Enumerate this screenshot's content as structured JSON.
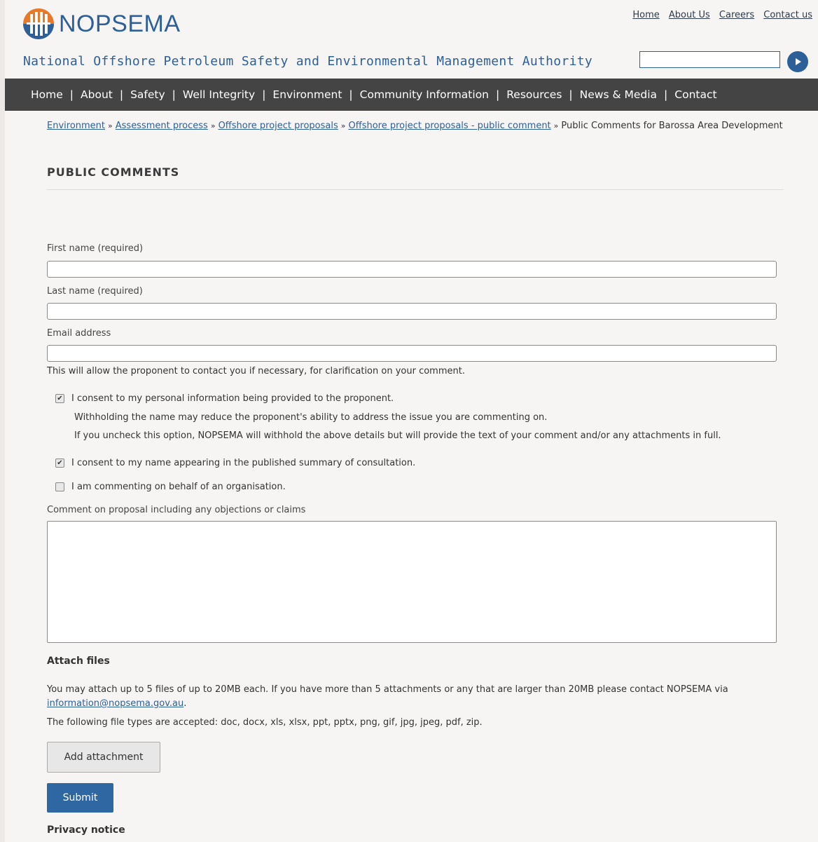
{
  "brand": {
    "name": "NOPSEMA",
    "tagline": "National Offshore Petroleum Safety and Environmental Management Authority"
  },
  "top_links": [
    "Home",
    "About Us",
    "Careers",
    "Contact us"
  ],
  "search": {
    "value": ""
  },
  "nav": [
    "Home",
    "About",
    "Safety",
    "Well Integrity",
    "Environment",
    "Community Information",
    "Resources",
    "News & Media",
    "Contact"
  ],
  "breadcrumb": {
    "links": [
      "Environment",
      "Assessment process",
      "Offshore project proposals",
      "Offshore project proposals - public comment"
    ],
    "current": "Public Comments for Barossa Area Development"
  },
  "page_title": "PUBLIC COMMENTS",
  "form": {
    "first_name_label": "First name (required)",
    "last_name_label": "Last name (required)",
    "email_label": "Email address",
    "email_help": "This will allow the proponent to contact you if necessary, for clarification on your comment.",
    "consent_info": {
      "label": "I consent to my personal information being provided to the proponent.",
      "checked": true
    },
    "consent_note_1": "Withholding the name may reduce the proponent's ability to address the issue you are commenting on.",
    "consent_note_2": "If you uncheck this option, NOPSEMA will withhold the above details but will provide the text of your comment and/or any attachments in full.",
    "consent_name": {
      "label": "I consent to my name appearing in the published summary of consultation.",
      "checked": true
    },
    "organisation": {
      "label": "I am commenting on behalf of an organisation.",
      "checked": false
    },
    "comment_label": "Comment on proposal including any objections or claims",
    "attach_heading": "Attach files",
    "attach_text": "You may attach up to 5 files of up to 20MB each. If you have  more than 5 attachments or any that are larger than 20MB please contact NOPSEMA via",
    "attach_email": "information@nopsema.gov.au",
    "file_types": "The following file types are accepted: doc, docx, xls, xlsx, ppt, pptx, png, gif, jpg, jpeg, pdf, zip.",
    "add_attachment_label": "Add attachment",
    "submit_label": "Submit",
    "privacy_heading": "Privacy notice"
  },
  "colors": {
    "brand_blue": "#2d5f99",
    "nav_bg": "#444444",
    "submit_bg": "#2f67a3",
    "logo_orange": "#e8782a"
  }
}
